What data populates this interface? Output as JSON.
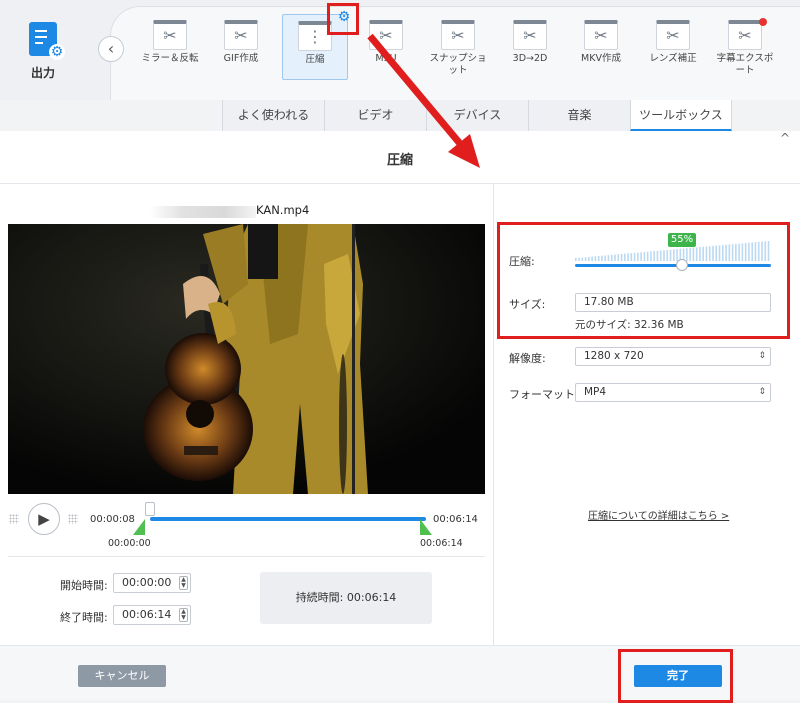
{
  "app": {
    "output_label": "出力",
    "accent": "#1e88e5",
    "highlight": "#e01e1e"
  },
  "toolbar": {
    "tools": [
      {
        "label": "ミラー＆反転",
        "icon": "tool-icon"
      },
      {
        "label": "GIF作成",
        "icon": "tool-icon"
      },
      {
        "label": "圧縮",
        "icon": "zip-icon",
        "active": true
      },
      {
        "label": "M3U",
        "icon": "tool-icon"
      },
      {
        "label": "スナップショット",
        "icon": "tool-icon"
      },
      {
        "label": "3D→2D",
        "icon": "tool-icon"
      },
      {
        "label": "MKV作成",
        "icon": "tool-icon"
      },
      {
        "label": "レンズ補正",
        "icon": "tool-icon"
      },
      {
        "label": "字幕エクスポート",
        "icon": "tool-icon",
        "badge": true
      }
    ]
  },
  "tabs": [
    "よく使われる",
    "ビデオ",
    "デバイス",
    "音楽",
    "ツールボックス"
  ],
  "dialog": {
    "title": "圧縮",
    "close": "^",
    "file_name_visible": "KAN.mp4",
    "player": {
      "current_time": "00:00:08",
      "end_time": "00:06:14",
      "start_marker": "00:00:00",
      "end_marker": "00:06:14"
    },
    "trim": {
      "start_label": "開始時間:",
      "start_value": "00:00:00",
      "end_label": "終了時間:",
      "end_value": "00:06:14",
      "duration_label": "持続時間:",
      "duration_value": "00:06:14"
    },
    "settings": {
      "compress_label": "圧縮:",
      "compress_percent_text": "55%",
      "compress_percent": 55,
      "size_label": "サイズ:",
      "size_value": "17.80  MB",
      "original_size": "元のサイズ: 32.36 MB",
      "resolution_label": "解像度:",
      "resolution_value": "1280 x 720",
      "format_label": "フォーマット:",
      "format_value": "MP4",
      "details_link": "圧縮についての詳細はこちら >"
    },
    "footer": {
      "cancel": "キャンセル",
      "done": "完了"
    }
  }
}
